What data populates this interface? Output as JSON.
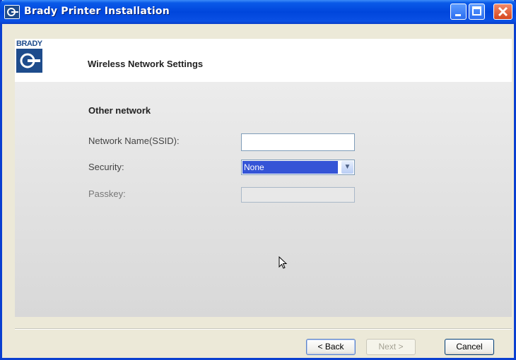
{
  "window": {
    "title": "Brady Printer Installation",
    "controls": [
      "minimize-icon",
      "maximize-icon",
      "close-icon"
    ]
  },
  "header": {
    "logo_text": "BRADY",
    "title": "Wireless Network Settings"
  },
  "form": {
    "section_title": "Other network",
    "ssid_label": "Network Name(SSID):",
    "ssid_value": "",
    "security_label": "Security:",
    "security_value": "None",
    "passkey_label": "Passkey:",
    "passkey_value": ""
  },
  "footer": {
    "back_label": "< Back",
    "next_label": "Next >",
    "cancel_label": "Cancel"
  },
  "colors": {
    "titlebar": "#0046dc",
    "selection": "#3454d6",
    "content_bg": "#e0e0e0"
  }
}
